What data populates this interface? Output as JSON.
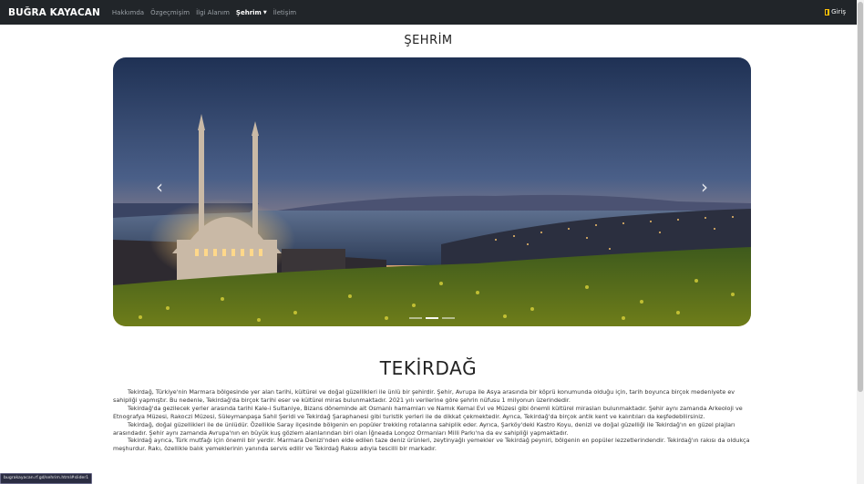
{
  "navbar": {
    "brand": "BUĞRA KAYACAN",
    "links": [
      "Hakkımda",
      "Özgeçmişim",
      "İlgi Alanım",
      "Şehrim",
      "İletişim"
    ],
    "active_link": "Şehrim",
    "login_label": "Giriş"
  },
  "page": {
    "title": "ŞEHRİM",
    "section_heading": "TEKİRDAĞ"
  },
  "carousel": {
    "prev_label": "‹",
    "next_label": "›",
    "slide_count": 3,
    "active_index": 1
  },
  "content": {
    "paragraphs": [
      "Tekirdağ, Türkiye'nin Marmara bölgesinde yer alan tarihi, kültürel ve doğal güzellikleri ile ünlü bir şehirdir. Şehir, Avrupa ile Asya arasında bir köprü konumunda olduğu için, tarih boyunca birçok medeniyete ev sahipliği yapmıştır. Bu nedenle, Tekirdağ'da birçok tarihi eser ve kültürel miras bulunmaktadır. 2021 yılı verilerine göre şehrin nüfusu 1 milyonun üzerindedir.",
      "Tekirdağ'da gezilecek yerler arasında tarihi Kale-i Sultaniye, Bizans döneminde ait Osmanlı hamamları ve Namık Kemal Evi ve Müzesi gibi önemli kültürel mirasları bulunmaktadır. Şehir aynı zamanda Arkeoloji ve Etnografya Müzesi, Rakoczi Müzesi, Süleymanpaşa Sahil Şeridi ve Tekirdağ Şaraphanesi gibi turistik yerleri ile de dikkat çekmektedir. Ayrıca, Tekirdağ'da birçok antik kent ve kalıntıları da keşfedebilirsiniz.",
      "Tekirdağ, doğal güzellikleri ile de ünlüdür. Özellikle Saray ilçesinde bölgenin en popüler trekking rotalarına sahiplik eder. Ayrıca, Şarköy'deki Kastro Koyu, denizi ve doğal güzelliği ile Tekirdağ'ın en güzel plajları arasındadır. Şehir aynı zamanda Avrupa'nın en büyük kuş gözlem alanlarından biri olan İğneada Longoz Ormanları Milli Parkı'na da ev sahipliği yapmaktadır.",
      "Tekirdağ ayrıca, Türk mutfağı için önemli bir yerdir. Marmara Denizi'nden elde edilen taze deniz ürünleri, zeytinyağlı yemekler ve Tekirdağ peyniri, bölgenin en popüler lezzetlerindendir. Tekirdağ'ın rakısı da oldukça meşhurdur. Rakı, özellikle balık yemeklerinin yanında servis edilir ve Tekirdağ Rakısı adıyla tescilli bir markadır."
    ]
  },
  "status_bar": {
    "url": "bugrakayacan.rf.gd/sehrim.html#slider1"
  },
  "colors": {
    "navbar_bg": "#212529",
    "nav_link": "#9aa0a6",
    "login_icon": "#ffc107"
  },
  "icons": {
    "login": "login-door-icon",
    "prev": "chevron-left-icon",
    "next": "chevron-right-icon"
  }
}
